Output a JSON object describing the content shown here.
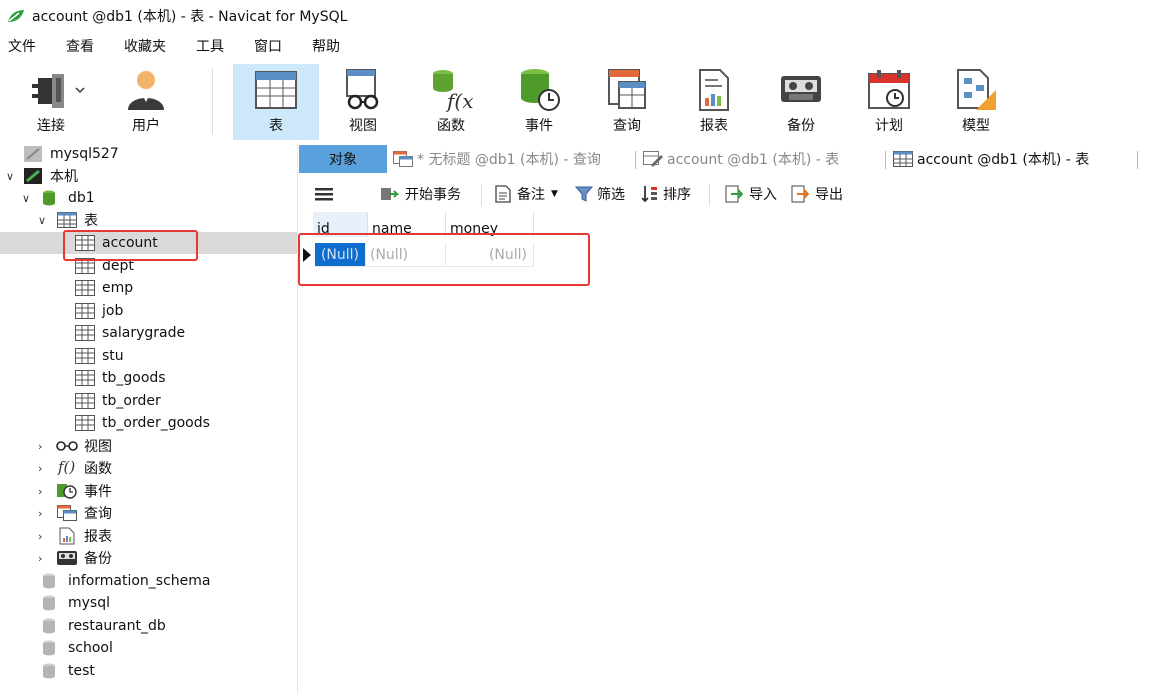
{
  "window": {
    "title": "account @db1 (本机) - 表 - Navicat for MySQL"
  },
  "menu": [
    "文件",
    "查看",
    "收藏夹",
    "工具",
    "窗口",
    "帮助"
  ],
  "toolbar": {
    "connect": "连接",
    "user": "用户",
    "table": "表",
    "view": "视图",
    "function": "函数",
    "event": "事件",
    "query": "查询",
    "report": "报表",
    "backup": "备份",
    "schedule": "计划",
    "model": "模型"
  },
  "tree": {
    "conn1": "mysql527",
    "conn2": "本机",
    "db1": "db1",
    "tables_group": "表",
    "tables": [
      "account",
      "dept",
      "emp",
      "job",
      "salarygrade",
      "stu",
      "tb_goods",
      "tb_order",
      "tb_order_goods"
    ],
    "groups": [
      "视图",
      "函数",
      "事件",
      "查询",
      "报表",
      "备份"
    ],
    "other_dbs": [
      "information_schema",
      "mysql",
      "restaurant_db",
      "school",
      "test"
    ]
  },
  "tabs": {
    "objects": "对象",
    "tab1": "* 无标题 @db1 (本机) - 查询",
    "tab2": "account @db1 (本机) - 表",
    "tab3": "account @db1 (本机) - 表"
  },
  "subtoolbar": {
    "begin_tx": "开始事务",
    "note": "备注",
    "filter": "筛选",
    "sort": "排序",
    "import": "导入",
    "export": "导出"
  },
  "grid": {
    "columns": [
      "id",
      "name",
      "money"
    ],
    "row": [
      "(Null)",
      "(Null)",
      "(Null)"
    ]
  },
  "colors": {
    "accent": "#5aa0dc",
    "selected_cell": "#0f6ecd",
    "highlight": "#e53935"
  }
}
